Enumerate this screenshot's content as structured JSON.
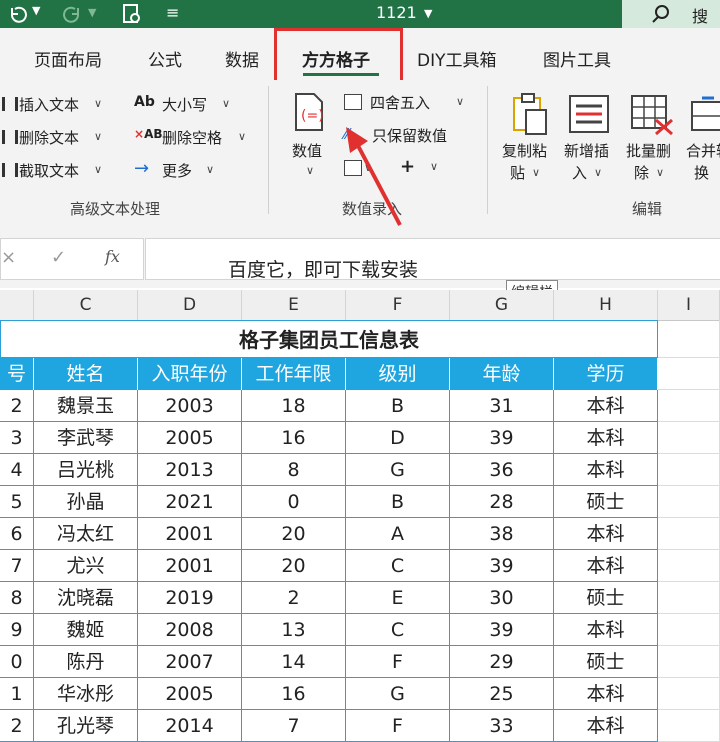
{
  "title_bar": {
    "file_name": "1121",
    "file_dropdown_icon": "chevron-down-icon",
    "search_label": "搜索"
  },
  "tabs": [
    "页面布局",
    "公式",
    "数据",
    "方方格子",
    "DIY工具箱",
    "图片工具"
  ],
  "active_tab": "方方格子",
  "ribbon": {
    "group_text": {
      "label": "高级文本处理",
      "items": [
        "插入文本",
        "删除文本",
        "截取文本"
      ],
      "items2": [
        "大小写",
        "删除空格",
        "更多"
      ]
    },
    "group_number": {
      "label": "数值录入",
      "big_button": "数值",
      "items": [
        "四舍五入",
        "只保留数值"
      ]
    },
    "group_edit": {
      "label": "编辑",
      "buttons": [
        {
          "line1": "复制粘",
          "line2": "贴"
        },
        {
          "line1": "新增插",
          "line2": "入"
        },
        {
          "line1": "批量删",
          "line2": "除"
        },
        {
          "line1": "合并转",
          "line2": "换"
        }
      ]
    }
  },
  "formula_bar": {
    "fx_label": "fx",
    "value": "百度它，即可下载安装",
    "tooltip": "编辑栏"
  },
  "columns": [
    "C",
    "D",
    "E",
    "F",
    "G",
    "H",
    "I"
  ],
  "sheet": {
    "title": "格子集团员工信息表",
    "headers": [
      "号",
      "姓名",
      "入职年份",
      "工作年限",
      "级别",
      "年龄",
      "学历"
    ],
    "rows": [
      [
        "2",
        "魏景玉",
        "2003",
        "18",
        "B",
        "31",
        "本科"
      ],
      [
        "3",
        "李武琴",
        "2005",
        "16",
        "D",
        "39",
        "本科"
      ],
      [
        "4",
        "吕光桃",
        "2013",
        "8",
        "G",
        "36",
        "本科"
      ],
      [
        "5",
        "孙晶",
        "2021",
        "0",
        "B",
        "28",
        "硕士"
      ],
      [
        "6",
        "冯太红",
        "2001",
        "20",
        "A",
        "38",
        "本科"
      ],
      [
        "7",
        "尤兴",
        "2001",
        "20",
        "C",
        "39",
        "本科"
      ],
      [
        "8",
        "沈晓磊",
        "2019",
        "2",
        "E",
        "30",
        "硕士"
      ],
      [
        "9",
        "魏姬",
        "2008",
        "13",
        "C",
        "39",
        "本科"
      ],
      [
        "0",
        "陈丹",
        "2007",
        "14",
        "F",
        "29",
        "硕士"
      ],
      [
        "1",
        "华冰彤",
        "2005",
        "16",
        "G",
        "25",
        "本科"
      ],
      [
        "2",
        "孔光琴",
        "2014",
        "7",
        "F",
        "33",
        "本科"
      ]
    ]
  },
  "colors": {
    "brand_green": "#217346",
    "header_blue": "#1fa6e0",
    "highlight_red": "#e03030"
  }
}
